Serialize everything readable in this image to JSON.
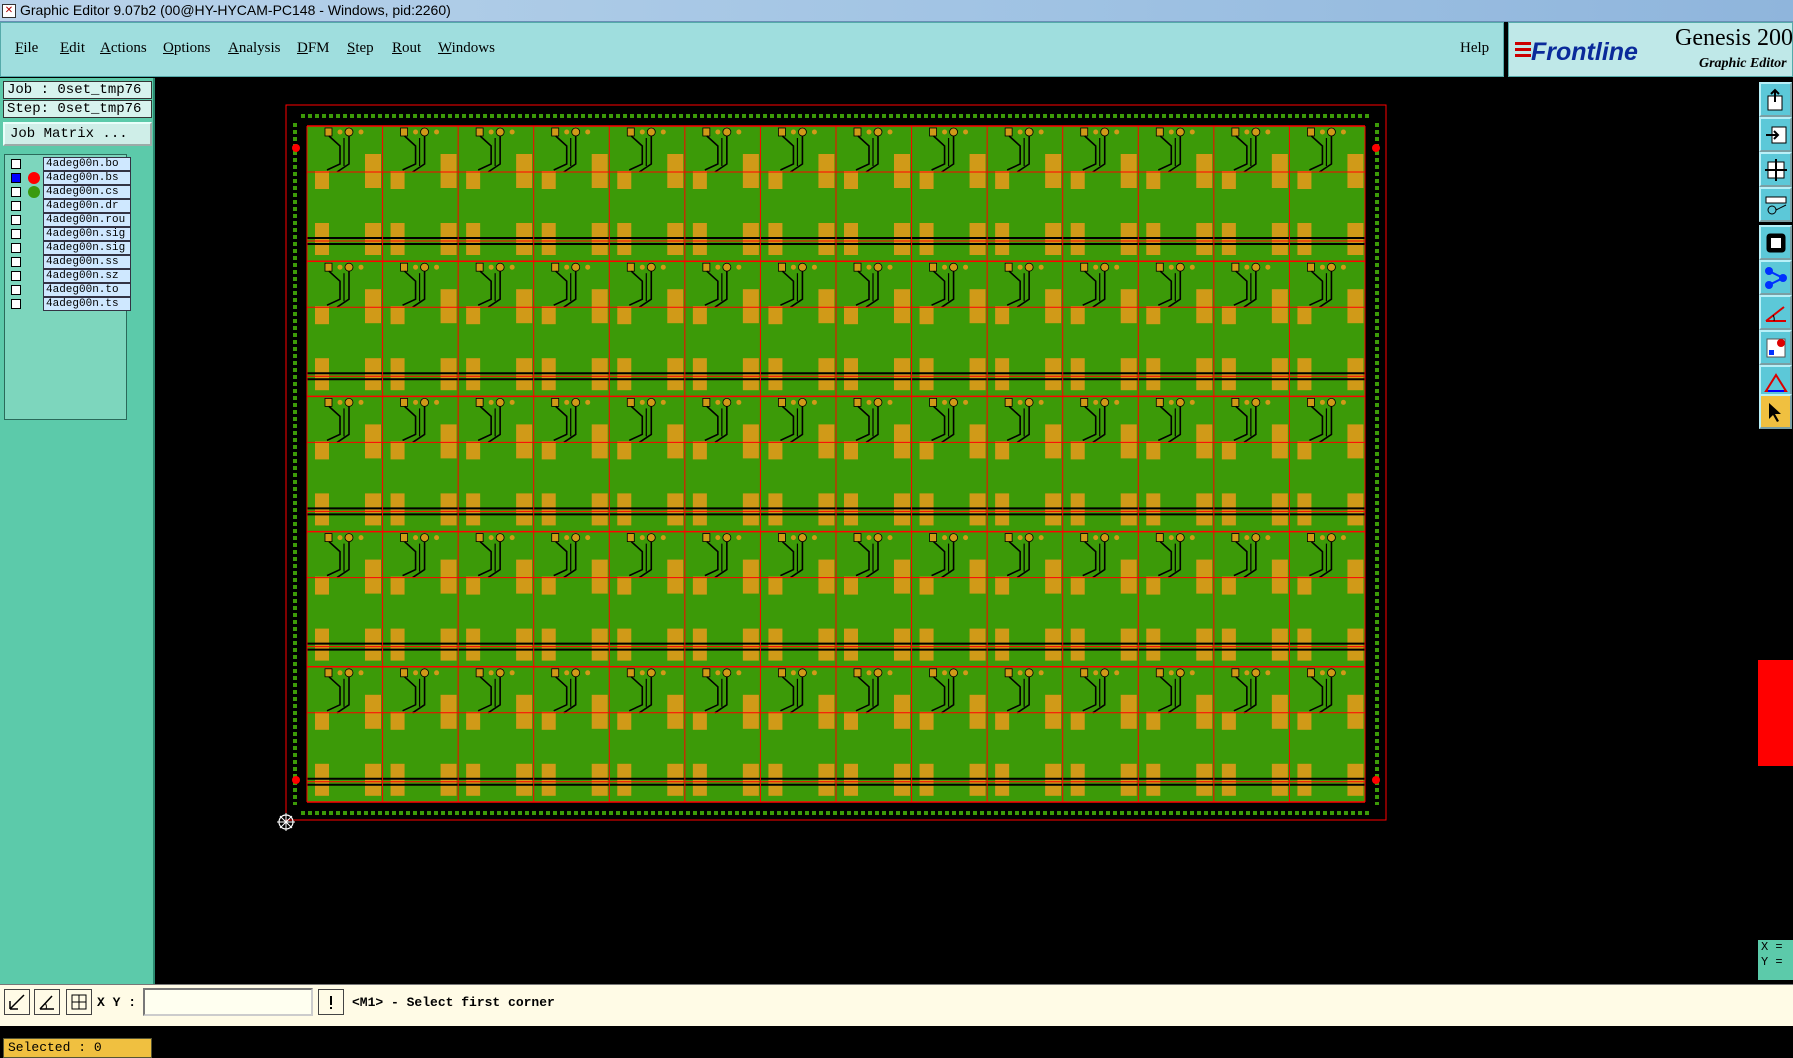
{
  "window": {
    "title": "Graphic Editor 9.07b2 (00@HY-HYCAM-PC148 - Windows, pid:2260)"
  },
  "menu": [
    {
      "key": "F",
      "rest": "ile"
    },
    {
      "key": "E",
      "rest": "dit"
    },
    {
      "key": "A",
      "rest": "ctions"
    },
    {
      "key": "O",
      "rest": "ptions"
    },
    {
      "key": "A",
      "rest": "nalysis"
    },
    {
      "key": "D",
      "rest": "FM"
    },
    {
      "key": "S",
      "rest": "tep"
    },
    {
      "key": "R",
      "rest": "out"
    },
    {
      "key": "W",
      "rest": "indows"
    }
  ],
  "help_label": "Help",
  "brand": {
    "logo_text": "Frontline",
    "product": "Genesis 200",
    "subtitle": "Graphic Editor"
  },
  "job": {
    "job_line": "Job : 0set_tmp76",
    "step_line": "Step: 0set_tmp76",
    "matrix_button": "Job Matrix ..."
  },
  "layers": [
    {
      "name": "4adeg00n.bo",
      "checked": false,
      "dot": ""
    },
    {
      "name": "4adeg00n.bs",
      "checked": true,
      "dot": "#ff0000"
    },
    {
      "name": "4adeg00n.cs",
      "checked": false,
      "dot": "#3a9a10"
    },
    {
      "name": "4adeg00n.dr",
      "checked": false,
      "dot": ""
    },
    {
      "name": "4adeg00n.rou",
      "checked": false,
      "dot": ""
    },
    {
      "name": "4adeg00n.sig",
      "checked": false,
      "dot": ""
    },
    {
      "name": "4adeg00n.sig",
      "checked": false,
      "dot": ""
    },
    {
      "name": "4adeg00n.ss",
      "checked": false,
      "dot": ""
    },
    {
      "name": "4adeg00n.sz",
      "checked": false,
      "dot": ""
    },
    {
      "name": "4adeg00n.to",
      "checked": false,
      "dot": ""
    },
    {
      "name": "4adeg00n.ts",
      "checked": false,
      "dot": ""
    }
  ],
  "selected_text": "Selected : 0",
  "coords": {
    "x_label": "X =",
    "y_label": "Y ="
  },
  "bottom": {
    "xy_label": "X Y :",
    "xy_value": "",
    "status": "<M1> - Select first corner"
  },
  "board": {
    "rows": 5,
    "cols": 14,
    "colors": {
      "substrate": "#3c9a08",
      "pad": "#d09a18",
      "outline": "#ff0000",
      "trace": "#000000",
      "frame_dots": "#3c9a08"
    }
  },
  "right_tools": [
    {
      "icon": "export-icon",
      "active": false
    },
    {
      "icon": "import-icon",
      "active": false
    },
    {
      "icon": "fit-icon",
      "active": false
    },
    {
      "icon": "measure-icon",
      "active": false
    },
    {
      "icon": "layer-toggle-icon",
      "active": false
    },
    {
      "icon": "snap-icon",
      "active": false
    },
    {
      "icon": "angle-icon",
      "active": false
    },
    {
      "icon": "features-icon",
      "active": false
    },
    {
      "icon": "triangle-icon",
      "active": false
    },
    {
      "icon": "pointer-icon",
      "active": true
    }
  ]
}
